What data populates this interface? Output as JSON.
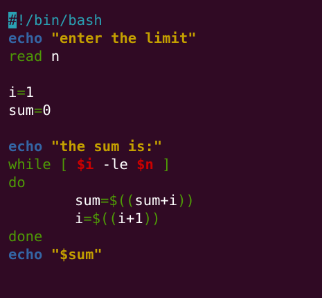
{
  "editor": {
    "lines": [
      {
        "cursor": "#",
        "comment": "!/bin/bash"
      },
      {
        "cmd": "echo",
        "space": " ",
        "string": "\"enter the limit\""
      },
      {
        "cmd": "read",
        "space": " ",
        "arg": "n"
      },
      {},
      {
        "var": "i",
        "op": "=",
        "val": "1"
      },
      {
        "var": "sum",
        "op": "=",
        "val": "0"
      },
      {},
      {
        "cmd": "echo",
        "space": " ",
        "string": "\"the sum is:\""
      },
      {
        "kw": "while",
        "open": " [ ",
        "v1": "$i",
        "op": " -le ",
        "v2": "$n",
        "close": " ]"
      },
      {
        "kw": "do"
      },
      {
        "var": "sum",
        "op": "=",
        "expr_open": "$((",
        "expr": "sum+i",
        "expr_close": "))"
      },
      {
        "var": "i",
        "op": "=",
        "expr_open": "$((",
        "expr": "i+1",
        "expr_close": "))"
      },
      {
        "kw": "done"
      },
      {
        "cmd": "echo",
        "space": " ",
        "string": "\"$sum\""
      }
    ]
  },
  "colors": {
    "background": "#300a24",
    "cursor": "#2aa1b3",
    "builtin": "#3465a4",
    "string": "#c4a000",
    "keyword": "#4e9a06",
    "variable": "#cc0000",
    "text": "#ffffff"
  }
}
